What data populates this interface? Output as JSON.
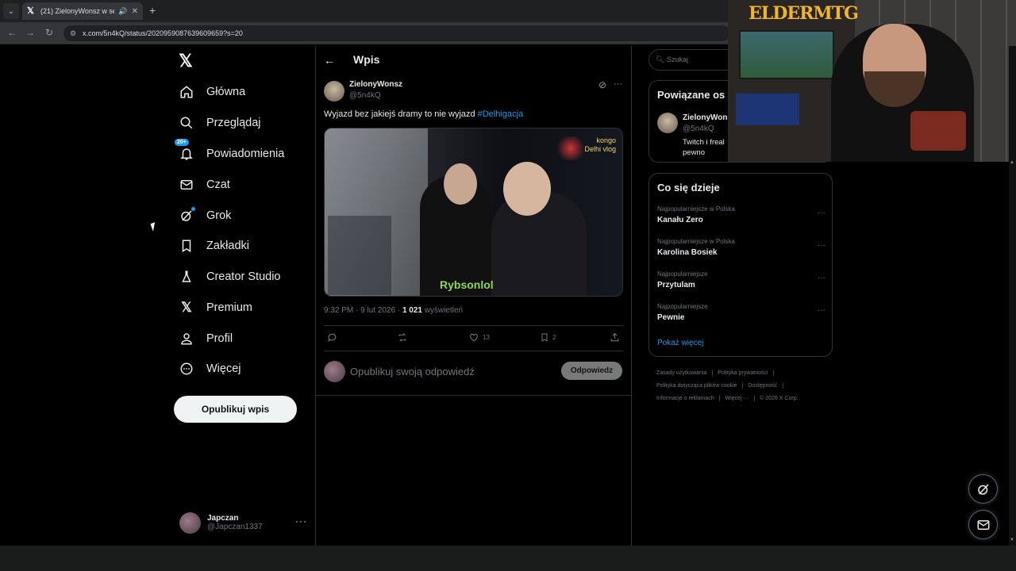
{
  "browser": {
    "tab_title": "(21) ZielonyWonsz w serwis",
    "url": "x.com/5n4kQ/status/2020959087639609659?s=20"
  },
  "nav": {
    "items": [
      {
        "label": "Główna",
        "icon": "home-icon"
      },
      {
        "label": "Przeglądaj",
        "icon": "search-icon"
      },
      {
        "label": "Powiadomienia",
        "icon": "bell-icon",
        "badge": "20+"
      },
      {
        "label": "Czat",
        "icon": "mail-icon"
      },
      {
        "label": "Grok",
        "icon": "grok-icon"
      },
      {
        "label": "Zakładki",
        "icon": "bookmark-icon"
      },
      {
        "label": "Creator Studio",
        "icon": "flask-icon"
      },
      {
        "label": "Premium",
        "icon": "x-logo-icon"
      },
      {
        "label": "Profil",
        "icon": "person-icon"
      },
      {
        "label": "Więcej",
        "icon": "more-circle-icon"
      }
    ],
    "post_button": "Opublikuj wpis",
    "account": {
      "name": "Japczan",
      "handle": "@Japczan1337"
    }
  },
  "main": {
    "title": "Wpis",
    "post": {
      "author": "ZielonyWonsz",
      "handle": "@5n4kQ",
      "text": "Wyjazd bez jakiejś dramy to nie wyjazd ",
      "hashtag": "#Delhigacja",
      "media_overlay_top": "kongo\nDelhi vlog",
      "media_overlay_bottom": "Rybsonlol",
      "time": "9:32 PM · 9 lut 2026 · ",
      "views": "1 021",
      "views_label": " wyświetleń",
      "replies": "",
      "reposts": "",
      "likes": "13",
      "bookmarks": "2"
    },
    "reply": {
      "placeholder": "Opublikuj swoją odpowiedź",
      "button": "Odpowiedz"
    }
  },
  "right": {
    "search_placeholder": "Szukaj",
    "related": {
      "title": "Powiązane os",
      "name": "ZielonyWon",
      "handle": "@5n4kQ",
      "bio": "Twitch i freal\npewno"
    },
    "trends": {
      "title": "Co się dzieje",
      "items": [
        {
          "context": "Najpopularniejsze w Polska",
          "title": "Kanału Zero"
        },
        {
          "context": "Najpopularniejsze w Polska",
          "title": "Karolina Bosiek"
        },
        {
          "context": "Najpopularniejsze",
          "title": "Przytulam"
        },
        {
          "context": "Najpopularniejsze",
          "title": "Pewnie"
        }
      ],
      "show_more": "Pokaż więcej"
    },
    "footer": {
      "links": [
        "Zasady użytkowania",
        "|",
        "Polityka prywatności",
        "|",
        "Polityka dotycząca plików cookie",
        "|",
        "Dostępność",
        "|",
        "Informacje o reklamach",
        "|",
        "Więcej ···",
        "|",
        "© 2026 X Corp."
      ]
    }
  },
  "webcam": {
    "logo_text": "ELDERMTG"
  },
  "colors": {
    "accent": "#1d9bf0",
    "background": "#000000",
    "muted": "#71767b",
    "border": "#2f3336"
  }
}
